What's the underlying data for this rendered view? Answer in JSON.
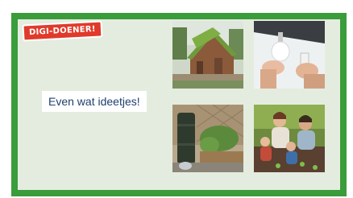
{
  "badge": {
    "label": "DIGI-DOENER!"
  },
  "slide": {
    "title": "Even wat ideetjes!"
  },
  "photos": [
    {
      "name": "green-roof-shed-photo"
    },
    {
      "name": "led-bulb-photo"
    },
    {
      "name": "rain-barrel-photo"
    },
    {
      "name": "family-gardening-photo"
    }
  ],
  "colors": {
    "frame": "#3a9c3a",
    "background": "#e4ecdf",
    "badge": "#e03a2a",
    "title_text": "#1f3f6e"
  }
}
